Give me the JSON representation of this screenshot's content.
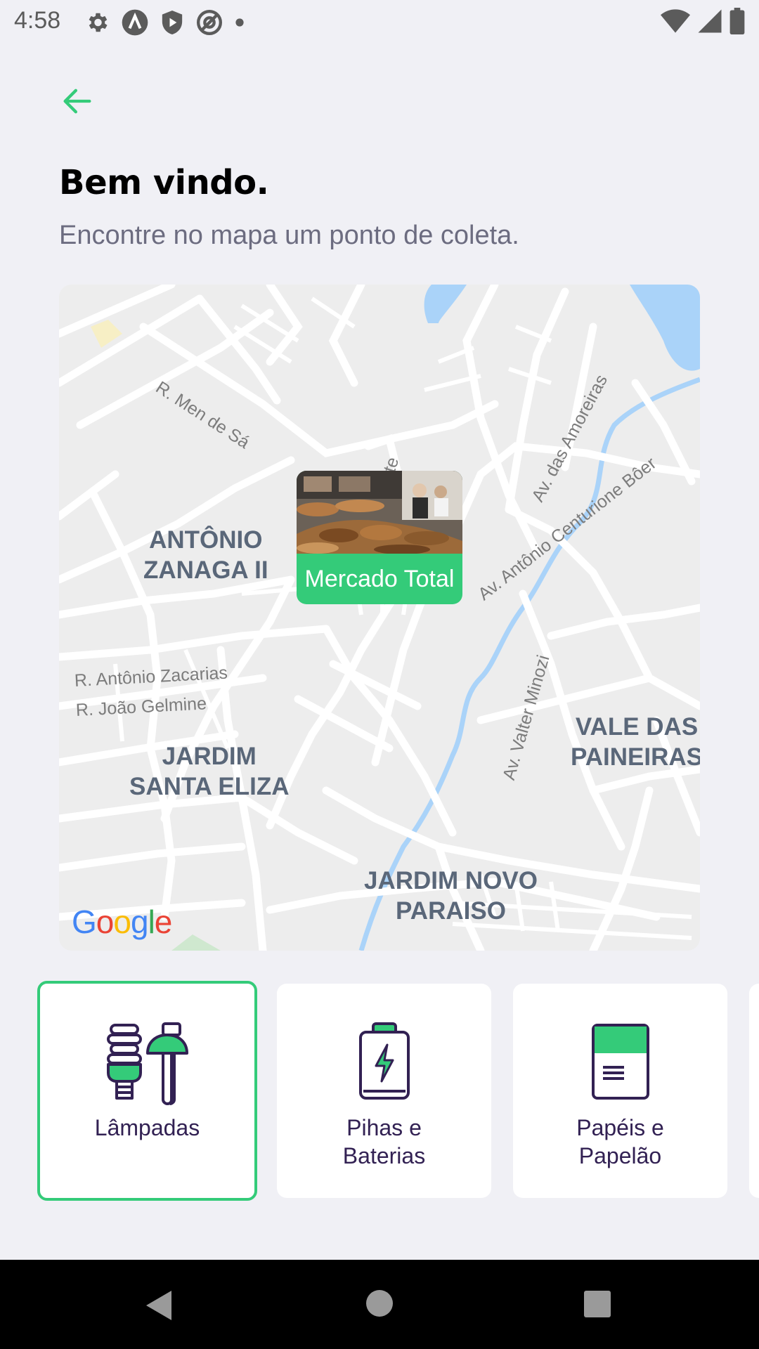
{
  "status_bar": {
    "time": "4:58",
    "left_icons": [
      "settings-gear-icon",
      "app-a-icon",
      "shield-play-icon",
      "at-sign-icon",
      "dot-icon"
    ],
    "right_icons": [
      "wifi-icon",
      "signal-icon",
      "battery-icon"
    ]
  },
  "header": {
    "back_icon": "arrow-left-icon",
    "title": "Bem vindo.",
    "subtitle": "Encontre no mapa um ponto de coleta."
  },
  "map": {
    "marker": {
      "label": "Mercado Total",
      "image": "market-photo"
    },
    "attribution": [
      "G",
      "o",
      "o",
      "g",
      "l",
      "e"
    ],
    "area_labels": {
      "antonio_zanaga_1": "ANTÔNIO",
      "antonio_zanaga_2": "ZANAGA II",
      "jardim_santa_eliza_1": "JARDIM",
      "jardim_santa_eliza_2": "SANTA ELIZA",
      "vale_das_paineiras_1": "VALE DAS",
      "vale_das_paineiras_2": "PAINEIRAS",
      "jardim_novo_paraiso_1": "JARDIM NOVO",
      "jardim_novo_paraiso_2": "PARAISO"
    },
    "street_labels": {
      "men_de_sa": "R. Men de Sá",
      "amoreiras": "Av. das Amoreiras",
      "centurione_boer": "Av. Antônio Centurione Bôer",
      "antonio_zacarias": "R. Antônio Zacarias",
      "joao_gelmine": "R. João Gelmine",
      "valter_minozi": "Av. Valter Minozi",
      "partial": "te"
    }
  },
  "items": [
    {
      "label_line1": "Lâmpadas",
      "label_line2": "",
      "icon": "lamps-icon",
      "selected": true
    },
    {
      "label_line1": "Pihas e",
      "label_line2": "Baterias",
      "icon": "battery-icon",
      "selected": false
    },
    {
      "label_line1": "Papéis e",
      "label_line2": "Papelão",
      "icon": "paper-icon",
      "selected": false
    }
  ],
  "colors": {
    "accent": "#34CB79",
    "background": "#F0F0F5",
    "title": "#000000",
    "subtitle": "#6C6C80",
    "item_text": "#322153",
    "icon_dark": "#322153"
  },
  "nav_bar": {
    "icons": [
      "nav-back-icon",
      "nav-home-icon",
      "nav-recents-icon"
    ]
  }
}
